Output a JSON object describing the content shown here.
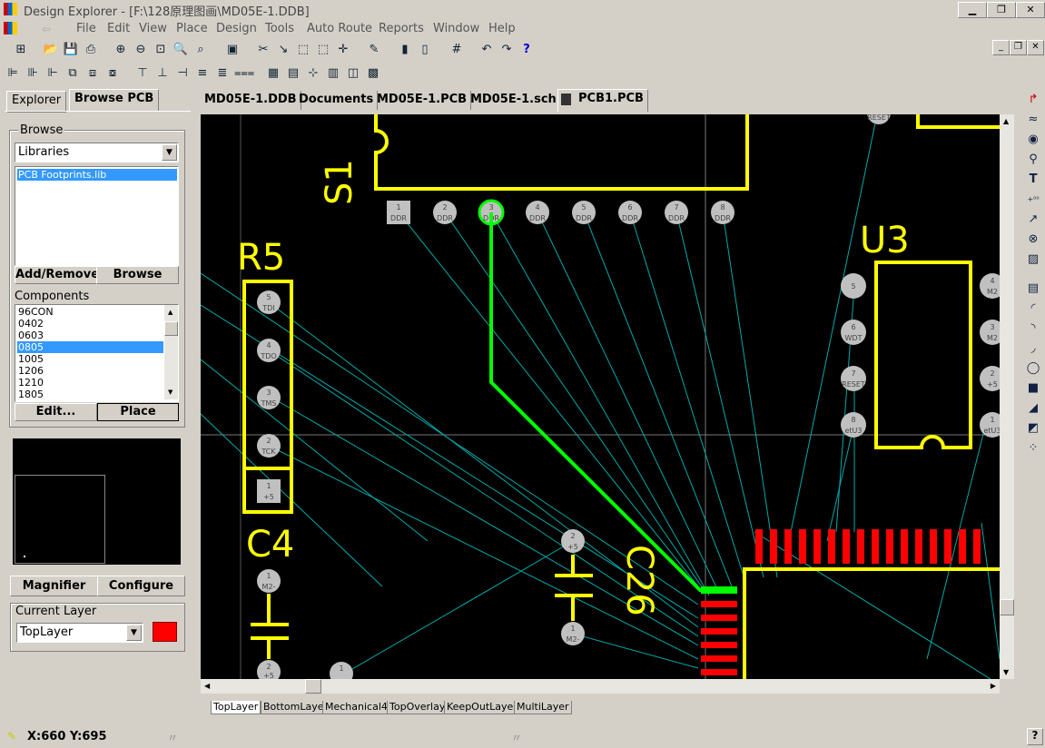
{
  "window": {
    "title": "Design Explorer - [F:\\128原理图画\\MD05E-1.DDB]"
  },
  "menu": [
    "File",
    "Edit",
    "View",
    "Place",
    "Design",
    "Tools",
    "Auto Route",
    "Reports",
    "Window",
    "Help"
  ],
  "panel": {
    "tabs": [
      "Explorer",
      "Browse PCB"
    ],
    "browse_label": "Browse",
    "browse_select": "Libraries",
    "library_items": [
      "PCB Footprints.lib"
    ],
    "add_remove_button": "Add/Remove..",
    "browse_button": "Browse",
    "components_label": "Components",
    "components": [
      "96CON",
      "0402",
      "0603",
      "0805",
      "1005",
      "1206",
      "1210",
      "1805"
    ],
    "selected_component": "0805",
    "edit_button": "Edit...",
    "place_button": "Place",
    "magnifier_button": "Magnifier",
    "configure_button": "Configure",
    "current_layer_label": "Current Layer",
    "current_layer": "TopLayer",
    "layer_color": "#ff0000"
  },
  "doc_tabs": [
    "MD05E-1.DDB",
    "Documents",
    "MD05E-1.PCB",
    "MD05E-1.sch",
    "PCB1.PCB"
  ],
  "active_doc_tab": "PCB1.PCB",
  "layer_tabs": [
    "TopLayer",
    "BottomLayer",
    "Mechanical4",
    "TopOverlay",
    "KeepOutLayer",
    "MultiLayer"
  ],
  "status": {
    "coords": "X:660 Y:695"
  },
  "pcb": {
    "designators": [
      "S1",
      "R5",
      "C4",
      "C26",
      "U3"
    ],
    "s1_pads": [
      {
        "num": "1",
        "net": "DDR"
      },
      {
        "num": "2",
        "net": "DDR"
      },
      {
        "num": "3",
        "net": "DDR"
      },
      {
        "num": "4",
        "net": "DDR"
      },
      {
        "num": "5",
        "net": "DDR"
      },
      {
        "num": "6",
        "net": "DDR"
      },
      {
        "num": "7",
        "net": "DDR"
      },
      {
        "num": "8",
        "net": "DDR"
      }
    ],
    "r5_pads": [
      {
        "num": "5",
        "net": "TDI"
      },
      {
        "num": "4",
        "net": "TDO"
      },
      {
        "num": "3",
        "net": "TMS"
      },
      {
        "num": "2",
        "net": "TCK"
      },
      {
        "num": "1",
        "net": "+5"
      }
    ],
    "u3_left_pads": [
      {
        "num": "5",
        "net": ""
      },
      {
        "num": "6",
        "net": "WDT"
      },
      {
        "num": "7",
        "net": "RESET"
      },
      {
        "num": "8",
        "net": "etU3"
      }
    ],
    "u3_right_pads": [
      {
        "num": "4",
        "net": "M2"
      },
      {
        "num": "3",
        "net": "M2"
      },
      {
        "num": "2",
        "net": "+5"
      },
      {
        "num": "1",
        "net": "etU3"
      }
    ],
    "c4_pads": [
      {
        "num": "1",
        "net": "M2-"
      },
      {
        "num": "2",
        "net": "+5"
      }
    ],
    "c26_pads": [
      {
        "num": "2",
        "net": "+5"
      },
      {
        "num": "1",
        "net": "M2-"
      }
    ],
    "misc_pads": [
      {
        "num": "1",
        "net": ""
      },
      {
        "num": "",
        "net": "RESET"
      }
    ],
    "colors": {
      "overlay": "#ffff00",
      "track": "#00ff00",
      "toppad": "#ff0000",
      "ratsnest": "#00aaaa",
      "padgray": "#c0c0c0"
    }
  }
}
